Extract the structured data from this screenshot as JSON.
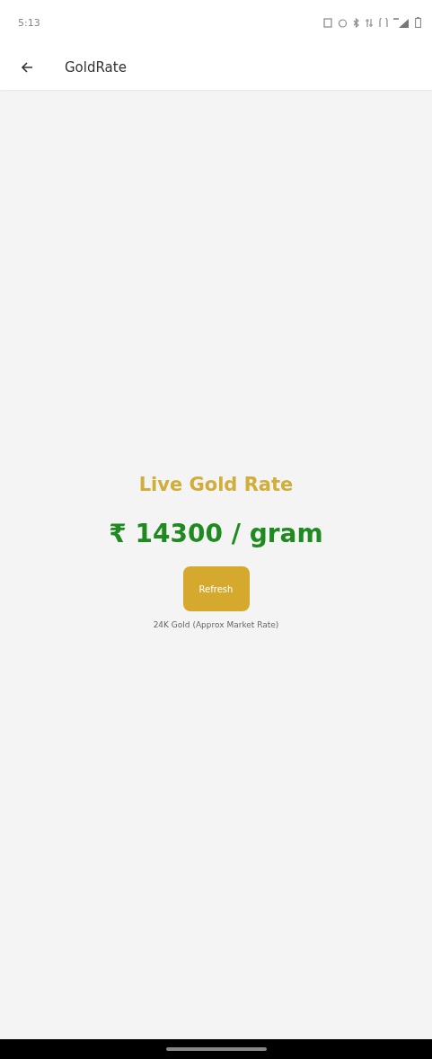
{
  "status_bar": {
    "time": "5:13"
  },
  "app_bar": {
    "title": "GoldRate"
  },
  "content": {
    "heading": "Live Gold Rate",
    "price": "₹ 14300 / gram",
    "button": "Refresh",
    "caption": "24K Gold (Approx Market Rate)"
  }
}
